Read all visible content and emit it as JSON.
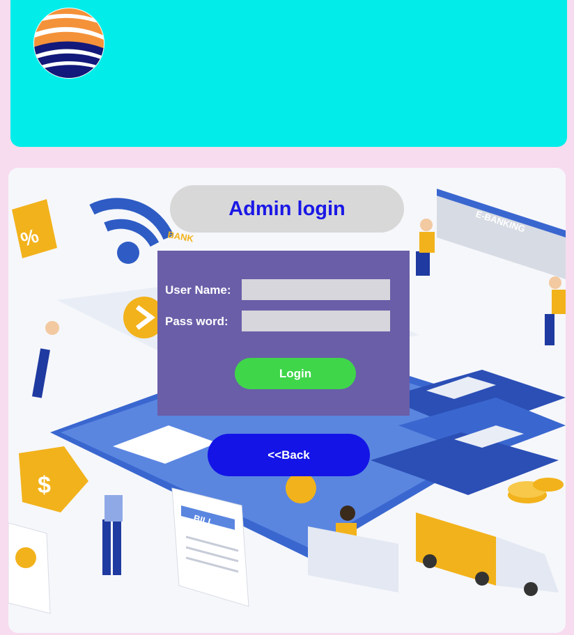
{
  "header": {
    "logo_icon": "sun-waves-logo-icon",
    "background_color": "#02ede9"
  },
  "page": {
    "background_color": "#f7dbef"
  },
  "illustration": {
    "icon": "online-banking-illustration",
    "labels": {
      "banner": "E-BANKING",
      "bill": "BILL",
      "bank": "BANK"
    }
  },
  "login": {
    "title": "Admin login",
    "username_label": "User Name:",
    "username_value": "",
    "password_label": "Pass word:",
    "password_value": "",
    "login_button": "Login",
    "back_button": "<<Back",
    "title_color": "#1b18e6",
    "panel_color": "#6a5ea8",
    "login_button_color": "#3fd64a",
    "back_button_color": "#1414e6"
  }
}
